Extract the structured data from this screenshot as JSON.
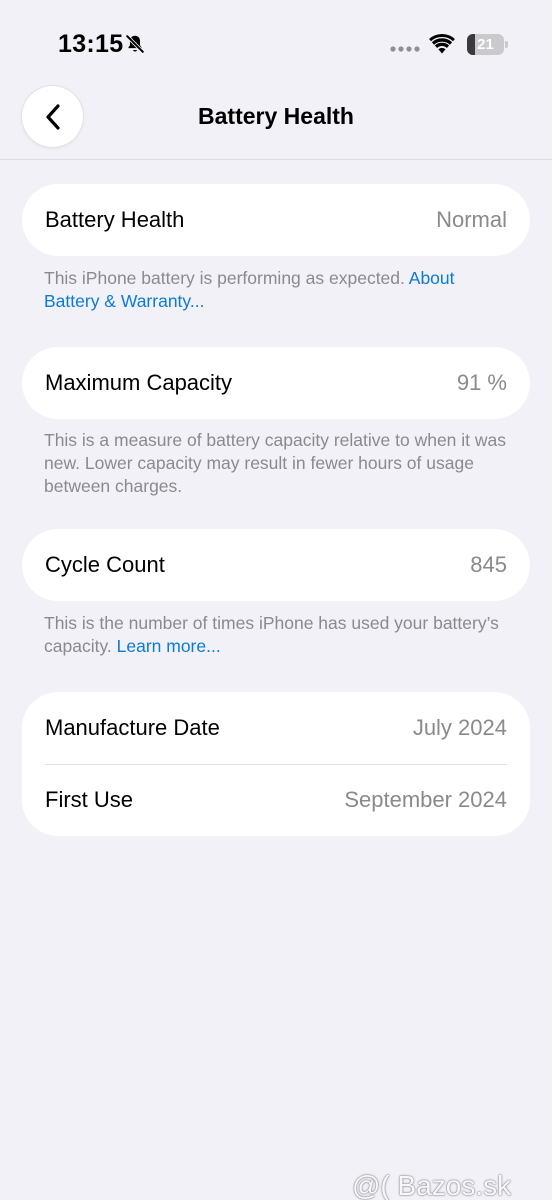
{
  "status_bar": {
    "time": "13:15",
    "battery_level": "21",
    "battery_fraction": 0.21,
    "icons": [
      "bell-slash-icon",
      "signal-dots-icon",
      "wifi-icon",
      "battery-icon"
    ]
  },
  "nav": {
    "title": "Battery Health",
    "back_icon": "chevron-left-icon"
  },
  "battery_health": {
    "label": "Battery Health",
    "value": "Normal",
    "footnote_text": "This iPhone battery is performing as expected. ",
    "footnote_link": "About Battery & Warranty..."
  },
  "maximum_capacity": {
    "label": "Maximum Capacity",
    "value": "91 %",
    "footnote_text": "This is a measure of battery capacity relative to when it was new. Lower capacity may result in fewer hours of usage between charges."
  },
  "cycle_count": {
    "label": "Cycle Count",
    "value": "845",
    "footnote_text": "This is the number of times iPhone has used your battery’s capacity. ",
    "footnote_link": "Learn more..."
  },
  "dates": {
    "manufacture_label": "Manufacture Date",
    "manufacture_value": "July 2024",
    "first_use_label": "First Use",
    "first_use_value": "September 2024"
  },
  "watermark": "@( Bazos.sk",
  "colors": {
    "background": "#f2f1f7",
    "card": "#ffffff",
    "secondary_text": "#8a8a8e",
    "link": "#0a7bd9"
  }
}
